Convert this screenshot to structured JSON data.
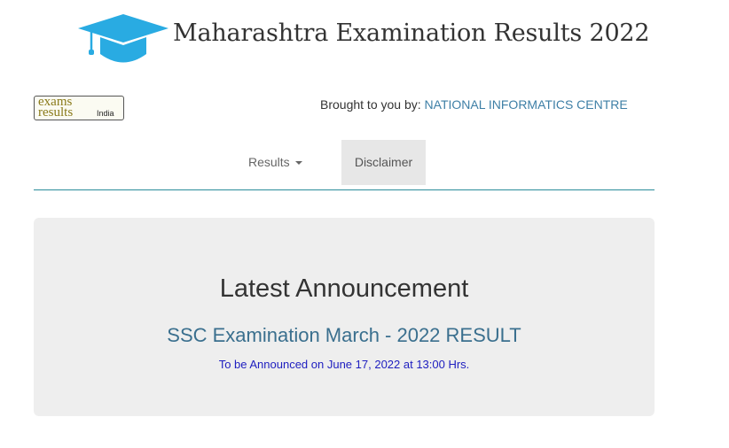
{
  "header": {
    "title": "Maharashtra Examination Results 2022",
    "icon": "graduation-cap-icon",
    "icon_color": "#29abe2"
  },
  "logo": {
    "line1": "exams",
    "line2": "results",
    "line3": "India"
  },
  "credit": {
    "prefix": "Brought to you by: ",
    "org": "NATIONAL INFORMATICS CENTRE",
    "org_color": "#3e7fa6"
  },
  "nav": {
    "results_label": "Results",
    "disclaimer_label": "Disclaimer",
    "divider_color": "#2a8c9a"
  },
  "announcement": {
    "heading": "Latest Announcement",
    "link": "SSC Examination March - 2022 RESULT",
    "note": "To be Announced on June 17, 2022 at 13:00 Hrs.",
    "link_color": "#3a6f8e",
    "note_color": "#2020c0"
  }
}
